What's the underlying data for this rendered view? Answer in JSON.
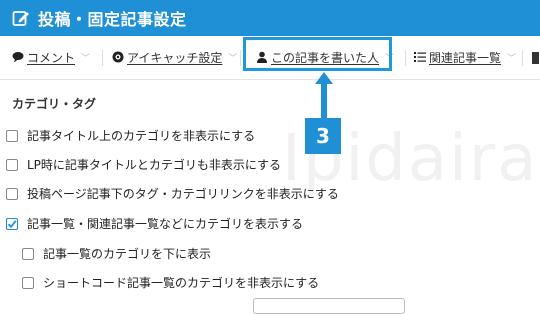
{
  "header": {
    "title": "投稿・固定記事設定",
    "icon": "edit-icon"
  },
  "tabs": [
    {
      "label": "コメント",
      "icon": "comment-icon"
    },
    {
      "label": "アイキャッチ設定",
      "icon": "eye-icon"
    },
    {
      "label": "この記事を書いた人",
      "icon": "person-icon"
    },
    {
      "label": "関連記事一覧",
      "icon": "list-icon"
    }
  ],
  "annotation": {
    "badge": "3"
  },
  "watermark": "Ipidaira",
  "section": {
    "title": "カテゴリ・タグ"
  },
  "options": [
    {
      "label": "記事タイトル上のカテゴリを非表示にする",
      "checked": false
    },
    {
      "label": "LP時に記事タイトルとカテゴリも非表示にする",
      "checked": false
    },
    {
      "label": "投稿ページ記事下のタグ・カテゴリリンクを非表示にする",
      "checked": false
    },
    {
      "label": "記事一覧・関連記事一覧などにカテゴリを表示する",
      "checked": true
    },
    {
      "label": "記事一覧のカテゴリを下に表示",
      "checked": false
    },
    {
      "label": "ショートコード記事一覧のカテゴリを非表示にする",
      "checked": false
    }
  ],
  "colors": {
    "accent": "#1f8fd6",
    "highlight": "#1f9ad6"
  }
}
